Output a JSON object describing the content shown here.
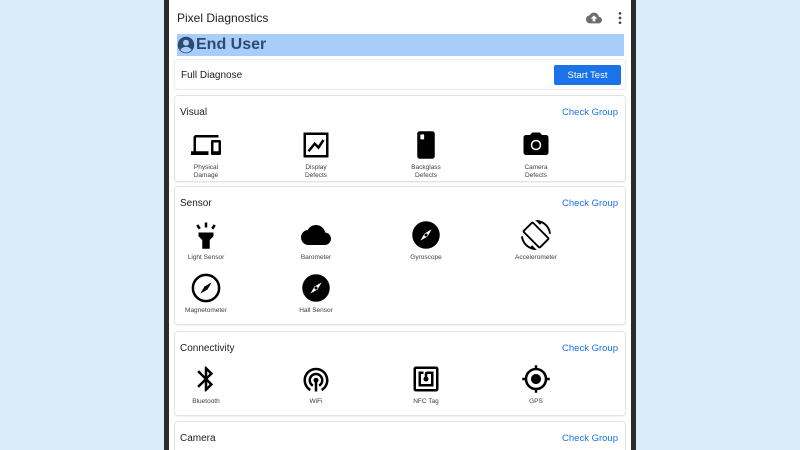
{
  "app": {
    "title": "Pixel Diagnostics"
  },
  "toolbar": {
    "cloud_icon": "cloud-upload-icon",
    "more_icon": "more-vert-icon"
  },
  "user": {
    "label": "End User",
    "icon": "account-circle-icon"
  },
  "full_diagnose": {
    "label": "Full Diagnose",
    "button": "Start Test"
  },
  "groups": {
    "visual": {
      "title": "Visual",
      "action": "Check Group",
      "items": [
        {
          "label": "Physical\nDamage",
          "icon": "devices-icon"
        },
        {
          "label": "Display\nDefects",
          "icon": "display-chart-icon"
        },
        {
          "label": "Backglass\nDefects",
          "icon": "phone-back-icon"
        },
        {
          "label": "Camera\nDefects",
          "icon": "camera-icon"
        }
      ]
    },
    "sensor": {
      "title": "Sensor",
      "action": "Check Group",
      "items": [
        {
          "label": "Light Sensor",
          "icon": "flashlight-icon"
        },
        {
          "label": "Barometer",
          "icon": "cloud-icon"
        },
        {
          "label": "Gyroscope",
          "icon": "compass-icon"
        },
        {
          "label": "Accelerometer",
          "icon": "screen-rotation-icon"
        },
        {
          "label": "Magnetometer",
          "icon": "compass-outline-icon"
        },
        {
          "label": "Hall Sensor",
          "icon": "compass-icon"
        }
      ]
    },
    "connectivity": {
      "title": "Connectivity",
      "action": "Check Group",
      "items": [
        {
          "label": "Bluetooth",
          "icon": "bluetooth-icon"
        },
        {
          "label": "WiFi",
          "icon": "wifi-tethering-icon"
        },
        {
          "label": "NFC Tag",
          "icon": "nfc-icon"
        },
        {
          "label": "GPS",
          "icon": "gps-fixed-icon"
        }
      ]
    },
    "camera": {
      "title": "Camera",
      "action": "Check Group"
    }
  },
  "colors": {
    "accent": "#1a73e8",
    "banner": "#a8cdf8",
    "banner_text": "#2f4a70",
    "background": "#d9ecf8"
  }
}
